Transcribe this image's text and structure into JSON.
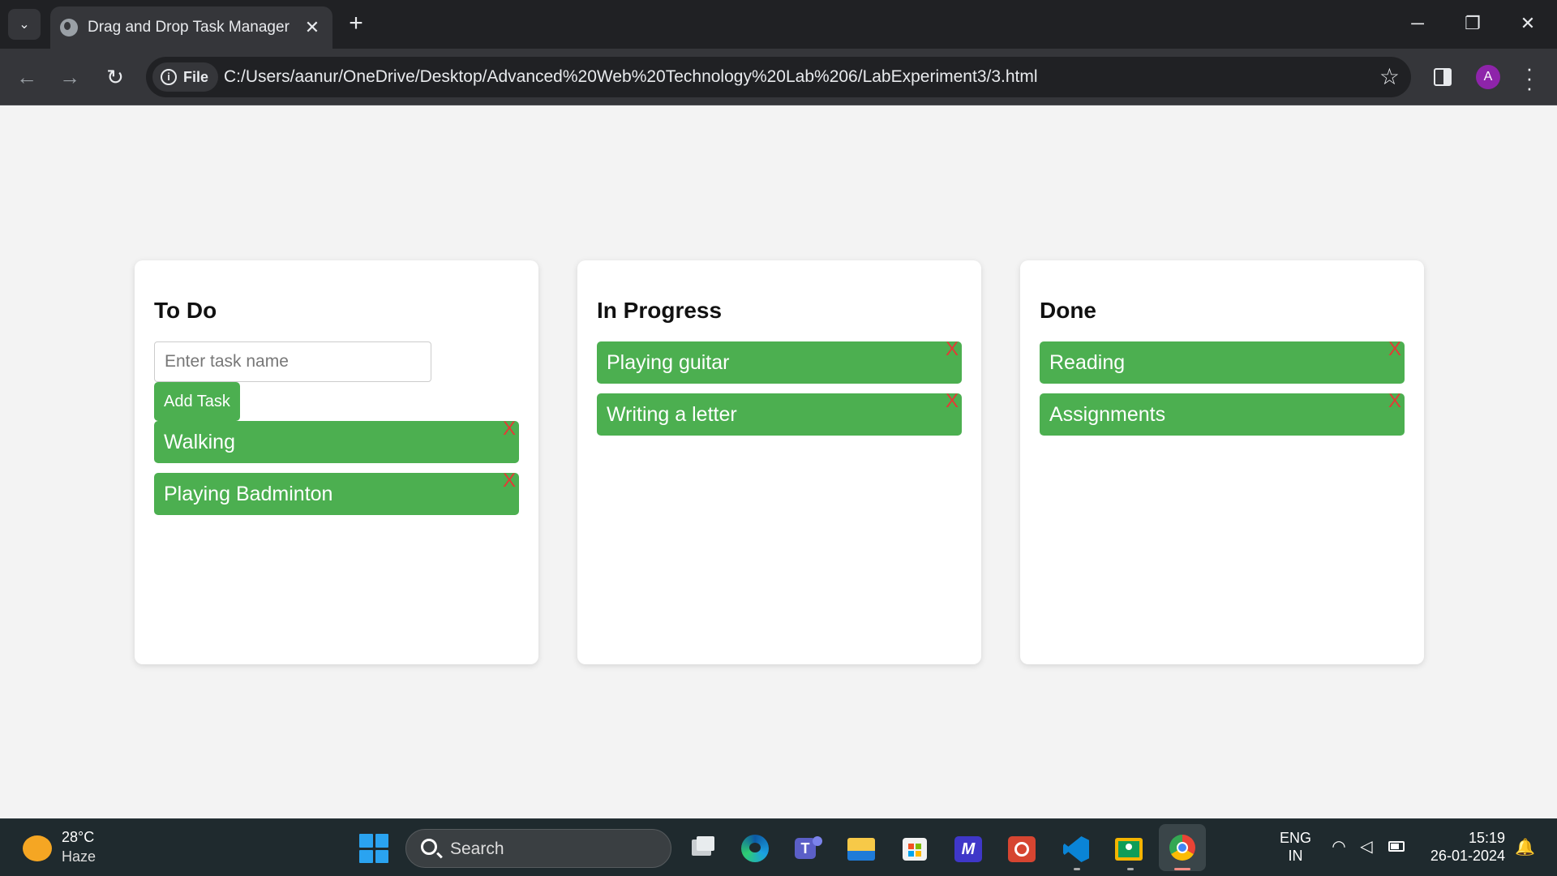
{
  "browser": {
    "tab_title": "Drag and Drop Task Manager",
    "tab_close": "✕",
    "new_tab": "+",
    "address_chip": "File",
    "url": "C:/Users/aanur/OneDrive/Desktop/Advanced%20Web%20Technology%20Lab%206/LabExperiment3/3.html",
    "profile_initial": "A",
    "window_controls": {
      "minimize": "─",
      "restore": "❐",
      "close": "✕"
    },
    "nav": {
      "back": "←",
      "forward": "→",
      "reload": "↻"
    }
  },
  "board": {
    "columns": [
      {
        "title": "To Do",
        "input_placeholder": "Enter task name",
        "add_button": "Add Task",
        "tasks": [
          "Walking",
          "Playing Badminton"
        ]
      },
      {
        "title": "In Progress",
        "tasks": [
          "Playing guitar",
          "Writing a letter"
        ]
      },
      {
        "title": "Done",
        "tasks": [
          "Reading",
          "Assignments"
        ]
      }
    ],
    "delete_label": "X",
    "colors": {
      "task_bg": "#4caf50",
      "delete_x": "#e53935",
      "column_bg": "#ffffff",
      "page_bg": "#f3f3f3"
    }
  },
  "taskbar": {
    "weather_temp": "28°C",
    "weather_desc": "Haze",
    "search_label": "Search",
    "lang_primary": "ENG",
    "lang_secondary": "IN",
    "time": "15:19",
    "date": "26-01-2024",
    "apps": [
      "task-view",
      "edge",
      "teams",
      "file-explorer",
      "microsoft-store",
      "vscode-blue-app",
      "red-app",
      "vscode",
      "classroom",
      "chrome"
    ]
  }
}
